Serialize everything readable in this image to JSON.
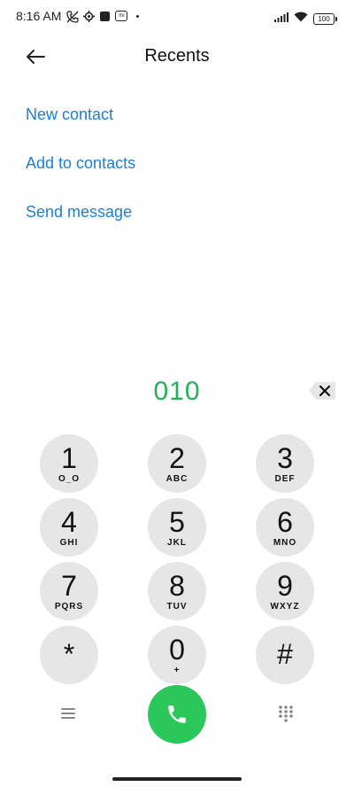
{
  "status_bar": {
    "time": "8:16 AM",
    "mi_label": "mi",
    "battery": "100"
  },
  "header": {
    "title": "Recents",
    "back_icon": "arrow-left-icon"
  },
  "actions": {
    "new_contact": "New contact",
    "add_to_contacts": "Add to contacts",
    "send_message": "Send message"
  },
  "dialer": {
    "number": "010",
    "backspace_icon": "backspace-icon"
  },
  "keypad": [
    {
      "digit": "1",
      "letters": "O_O"
    },
    {
      "digit": "2",
      "letters": "ABC"
    },
    {
      "digit": "3",
      "letters": "DEF"
    },
    {
      "digit": "4",
      "letters": "GHI"
    },
    {
      "digit": "5",
      "letters": "JKL"
    },
    {
      "digit": "6",
      "letters": "MNO"
    },
    {
      "digit": "7",
      "letters": "PQRS"
    },
    {
      "digit": "8",
      "letters": "TUV"
    },
    {
      "digit": "9",
      "letters": "WXYZ"
    },
    {
      "digit": "*",
      "letters": ""
    },
    {
      "digit": "0",
      "letters": "+"
    },
    {
      "digit": "#",
      "letters": ""
    }
  ],
  "bottom_bar": {
    "menu_icon": "menu-icon",
    "call_icon": "phone-icon",
    "dialpad_icon": "dialpad-icon"
  },
  "colors": {
    "accent_link": "#1c7fd6",
    "number_green": "#22b257",
    "call_green": "#2cc75a",
    "key_bg": "#e6e6e6"
  }
}
